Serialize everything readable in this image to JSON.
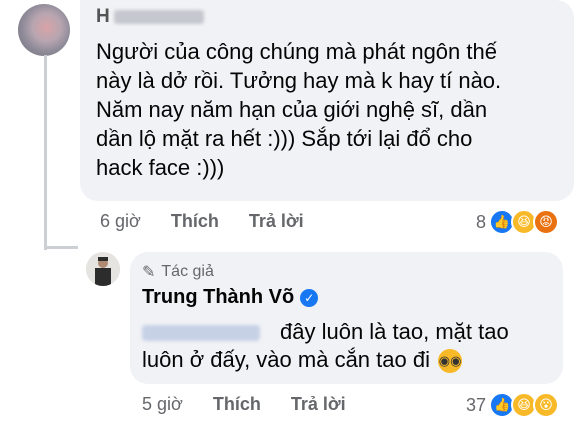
{
  "comment": {
    "author_initial": "H",
    "text": "Người của công chúng mà phát ngôn thế\nnày là dở rồi. Tưởng hay mà k hay tí nào.\nNăm nay năm hạn của giới nghệ sĩ, dần\ndần lộ mặt ra hết :))) Sắp tới lại đổ cho\nhack face :)))",
    "time": "6 giờ",
    "like_label": "Thích",
    "reply_label": "Trả lời",
    "reaction_count": "8",
    "reaction_icons": [
      "like-icon",
      "haha-icon",
      "angry-icon"
    ]
  },
  "reply": {
    "badge_label": "Tác giả",
    "author_name": "Trung Thành Võ",
    "text": "đây luôn là tao, mặt tao luôn ở đấy, vào mà cắn tao đi",
    "time": "5 giờ",
    "like_label": "Thích",
    "reply_label": "Trả lời",
    "reaction_count": "37",
    "reaction_icons": [
      "like-icon",
      "haha-icon",
      "wow-icon"
    ]
  },
  "colors": {
    "bubble": "#f0f2f5",
    "meta_text": "#65676b",
    "like_blue": "#1877f2",
    "haha_yellow": "#f7b928",
    "angry_orange": "#e9710f",
    "thread_line": "#ccd0d5"
  }
}
